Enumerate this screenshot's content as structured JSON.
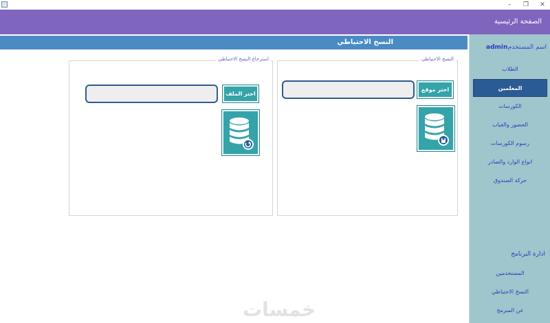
{
  "header": {
    "title": "الصفحة الرئيسية"
  },
  "user": {
    "label": "اسم المستخدم",
    "name": "admin"
  },
  "sidebar": {
    "items": [
      {
        "label": "الطلاب",
        "active": false
      },
      {
        "label": "المعلمين",
        "active": true
      },
      {
        "label": "الكورسات",
        "active": false
      },
      {
        "label": "الحضور والغياب",
        "active": false
      },
      {
        "label": "رسوم الكورسات",
        "active": false
      },
      {
        "label": "انواع الوارد والصادر",
        "active": false
      },
      {
        "label": "حركة الصندوق",
        "active": false
      }
    ],
    "section_title": "ادارة البرنامج",
    "admin_items": [
      {
        "label": "المستخدمين"
      },
      {
        "label": "النسخ الاحتياطي"
      },
      {
        "label": "عن المبرمج"
      }
    ]
  },
  "main": {
    "title": "النسخ الاحتياطي",
    "backup": {
      "title": "النسخ الاحتياطي",
      "button": "اختر موقع الحفظ",
      "path_value": ""
    },
    "restore": {
      "title": "استرجاع النسخ الاحتياطي",
      "button": "اختر الملف",
      "path_value": ""
    }
  },
  "watermark": "خمسات",
  "colors": {
    "header": "#8065bf",
    "sidebar": "#9fc6cc",
    "active": "#2a5b94",
    "accent": "#35a3aa",
    "bar": "#4a8bc4"
  }
}
